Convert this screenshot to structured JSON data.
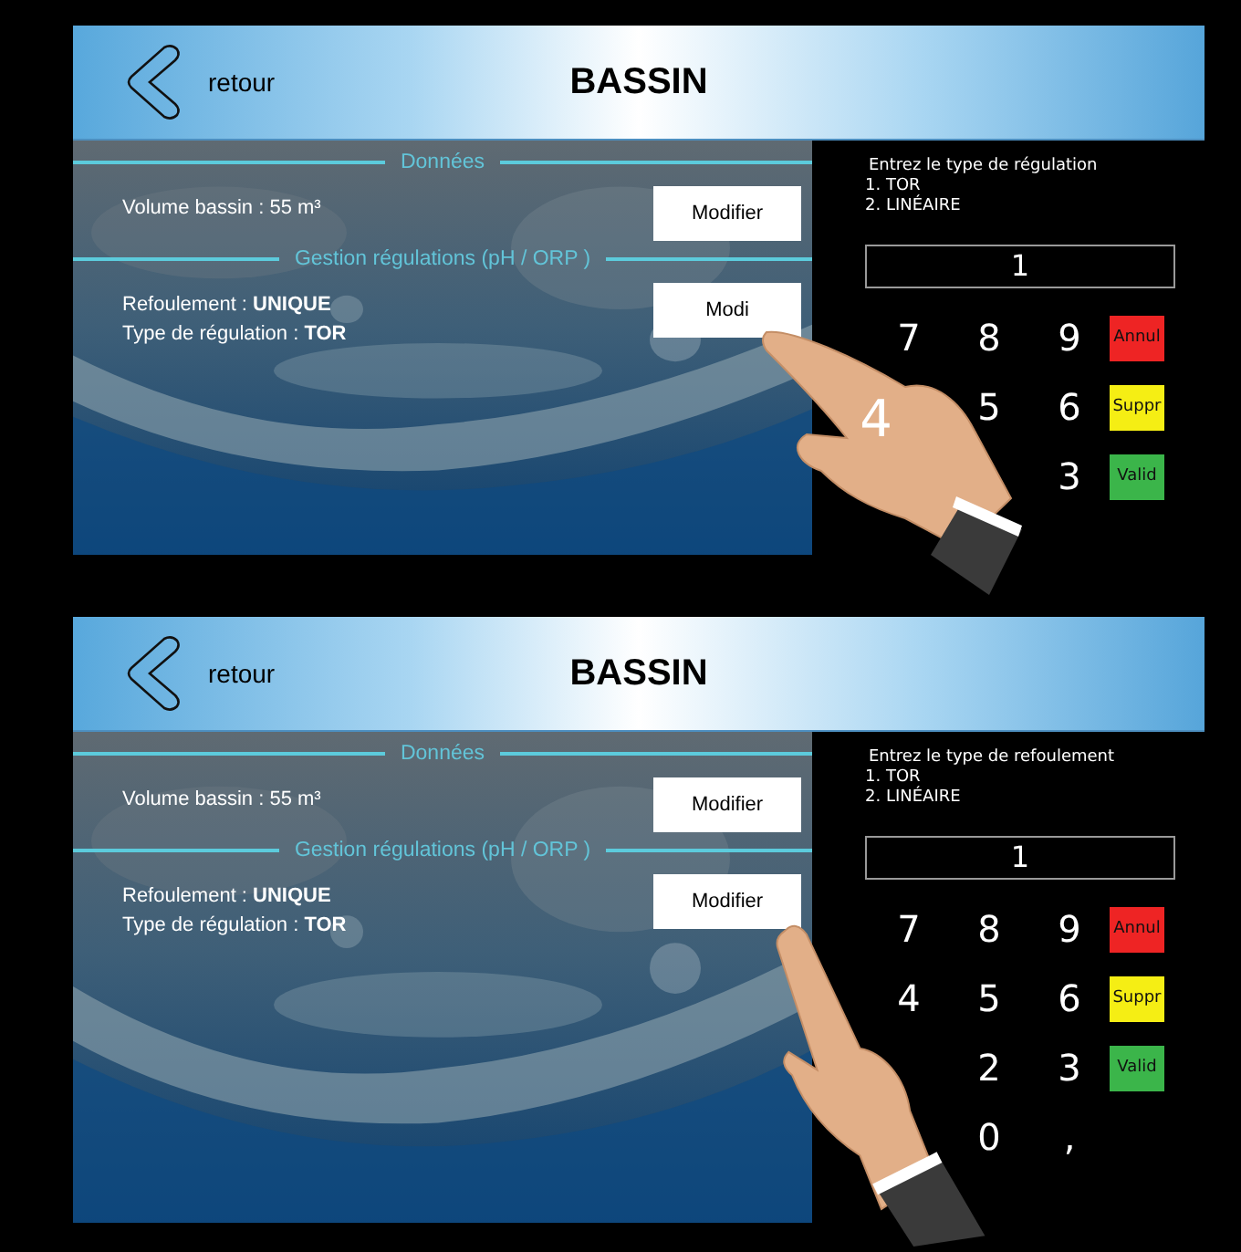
{
  "screens": [
    {
      "back_label": "retour",
      "title": "BASSIN",
      "sections": [
        {
          "heading": "Données",
          "lines": [
            "Volume bassin : 55 m³"
          ],
          "button": "Modifier"
        },
        {
          "heading": "Gestion régulations (pH / ORP )",
          "lines": [
            "Refoulement : **UNIQUE**",
            "Type de régulation : **TOR**"
          ],
          "button": "Modi"
        }
      ],
      "prompt": "Entrez le type de régulation",
      "options": [
        "1. TOR",
        "2. LINÉAIRE"
      ],
      "display": "1",
      "key_rows": [
        [
          {
            "label": "7",
            "pressed": false
          },
          {
            "label": "8",
            "pressed": false
          },
          {
            "label": "9",
            "pressed": false
          }
        ],
        [
          {
            "label": "4",
            "pressed": true
          },
          {
            "label": "5",
            "pressed": false
          },
          {
            "label": "6",
            "pressed": false
          }
        ],
        [
          null,
          null,
          {
            "label": "3",
            "pressed": false
          }
        ]
      ],
      "actions": [
        {
          "label": "Annul",
          "color": "#ee2424"
        },
        {
          "label": "Suppr",
          "color": "#f5ee14"
        },
        {
          "label": "Valid",
          "color": "#3bb54a"
        }
      ],
      "kind": "first"
    },
    {
      "back_label": "retour",
      "title": "BASSIN",
      "sections": [
        {
          "heading": "Données",
          "lines": [
            "Volume bassin : 55 m³"
          ],
          "button": "Modifier"
        },
        {
          "heading": "Gestion régulations (pH / ORP )",
          "lines": [
            "Refoulement : **UNIQUE**",
            "Type de régulation : **TOR**"
          ],
          "button": "Modifier"
        }
      ],
      "prompt": "Entrez le type de refoulement",
      "options": [
        "1. TOR",
        "2. LINÉAIRE"
      ],
      "display": "1",
      "key_rows": [
        [
          {
            "label": "7",
            "pressed": false
          },
          {
            "label": "8",
            "pressed": false
          },
          {
            "label": "9",
            "pressed": false
          }
        ],
        [
          {
            "label": "4",
            "pressed": false
          },
          {
            "label": "5",
            "pressed": false
          },
          {
            "label": "6",
            "pressed": false
          }
        ],
        [
          null,
          {
            "label": "2",
            "pressed": false
          },
          {
            "label": "3",
            "pressed": false
          }
        ],
        [
          null,
          {
            "label": "0",
            "pressed": false
          },
          {
            "label": ",",
            "pressed": false
          }
        ]
      ],
      "actions": [
        {
          "label": "Annul",
          "color": "#ee2424"
        },
        {
          "label": "Suppr",
          "color": "#f5ee14"
        },
        {
          "label": "Valid",
          "color": "#3bb54a"
        }
      ],
      "kind": "second"
    }
  ]
}
